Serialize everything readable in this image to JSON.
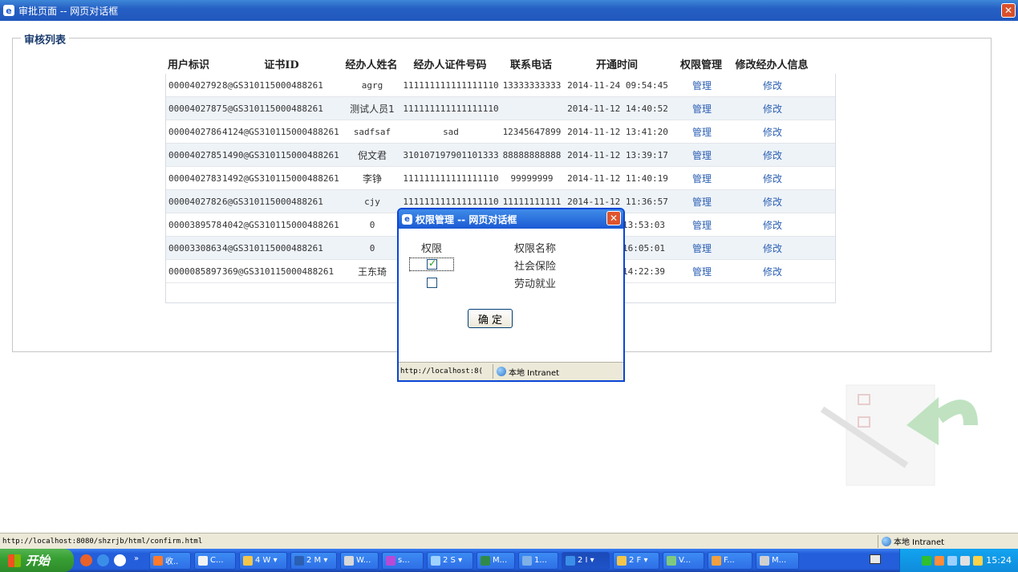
{
  "window": {
    "title": "审批页面 -- 网页对话框"
  },
  "fieldset": {
    "legend": "审核列表"
  },
  "table": {
    "headers": [
      "用户标识",
      "证书ID",
      "经办人姓名",
      "经办人证件号码",
      "联系电话",
      "开通时间",
      "权限管理",
      "修改经办人信息"
    ],
    "rows": [
      [
        "0000402792",
        "8@GS310115000488261",
        "agrg",
        "111111111111111110",
        "13333333333",
        "2014-11-24 09:54:45",
        "管理",
        "修改"
      ],
      [
        "0000402787",
        "5@GS310115000488261",
        "测试人员1",
        "111111111111111110",
        "",
        "2014-11-12 14:40:52",
        "管理",
        "修改"
      ],
      [
        "0000402786",
        "4124@GS310115000488261",
        "sadfsaf",
        "sad",
        "12345647899",
        "2014-11-12 13:41:20",
        "管理",
        "修改"
      ],
      [
        "0000402785",
        "1490@GS310115000488261",
        "倪文君",
        "310107197901101333",
        "88888888888",
        "2014-11-12 13:39:17",
        "管理",
        "修改"
      ],
      [
        "0000402783",
        "1492@GS310115000488261",
        "李铮",
        "111111111111111110",
        "99999999",
        "2014-11-12 11:40:19",
        "管理",
        "修改"
      ],
      [
        "0000402782",
        "6@GS310115000488261",
        "cjy",
        "111111111111111110",
        "11111111111",
        "2014-11-12 11:36:57",
        "管理",
        "修改"
      ],
      [
        "0000389578",
        "4042@GS310115000488261",
        "0",
        "",
        "",
        "13:53:03",
        "管理",
        "修改"
      ],
      [
        "0000330863",
        "4@GS310115000488261",
        "0",
        "",
        "",
        "16:05:01",
        "管理",
        "修改"
      ],
      [
        "0000085897",
        "369@GS310115000488261",
        "王东琦",
        "",
        "",
        "14:22:39",
        "管理",
        "修改"
      ]
    ]
  },
  "dialog": {
    "title": "权限管理 -- 网页对话框",
    "col_permission": "权限",
    "col_name": "权限名称",
    "items": [
      {
        "label": "社会保险",
        "checked": true
      },
      {
        "label": "劳动就业",
        "checked": false
      }
    ],
    "ok_label": "确 定",
    "status_url": "http://localhost:8(",
    "status_zone": "本地 Intranet"
  },
  "statusbar": {
    "url": "http://localhost:8080/shzrjb/html/confirm.html",
    "zone": "本地 Intranet"
  },
  "taskbar": {
    "start_label": "开始",
    "buttons": [
      {
        "label": "收.."
      },
      {
        "label": "C..."
      },
      {
        "label": "4 W"
      },
      {
        "label": "2 M"
      },
      {
        "label": "W..."
      },
      {
        "label": "s..."
      },
      {
        "label": "2 S"
      },
      {
        "label": "M..."
      },
      {
        "label": "1..."
      },
      {
        "label": "2 I"
      },
      {
        "label": "2 F"
      },
      {
        "label": "V..."
      },
      {
        "label": "F..."
      },
      {
        "label": "M..."
      }
    ],
    "clock": "15:24"
  }
}
